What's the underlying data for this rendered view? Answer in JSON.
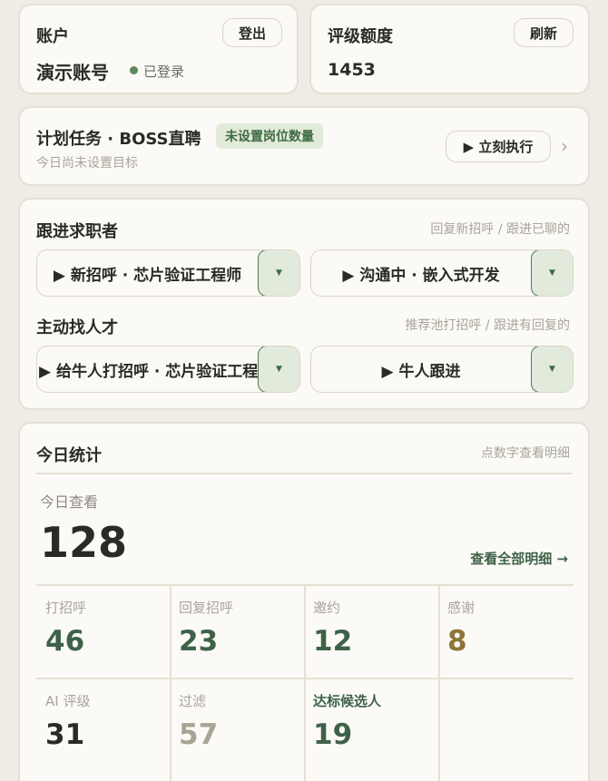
{
  "account": {
    "title": "账户",
    "logout_label": "登出",
    "name": "演示账号",
    "status": "已登录"
  },
  "rating": {
    "title": "评级额度",
    "refresh_label": "刷新",
    "value": "1453"
  },
  "plan": {
    "title": "计划任务 · BOSS直聘",
    "tag": "未设置岗位数量",
    "subtitle": "今日尚未设置目标",
    "run_label": "▶ 立刻执行",
    "chevron": "›"
  },
  "follow": {
    "title": "跟进求职者",
    "hint": "回复新招呼 / 跟进已聊的",
    "left_select": "▶ 新招呼 · 芯片验证工程师",
    "right_select": "▶ 沟通中 · 嵌入式开发"
  },
  "find": {
    "title": "主动找人才",
    "hint": "推荐池打招呼 / 跟进有回复的",
    "left_select": "▶ 给牛人打招呼 · 芯片验证工程师",
    "right_select": "▶ 牛人跟进"
  },
  "stats": {
    "title": "今日统计",
    "hint": "点数字查看明细",
    "views_label": "今日查看",
    "views_value": "128",
    "view_all": "查看全部明细 →",
    "cells": [
      {
        "label": "打招呼",
        "value": "46",
        "color": "#3e6248"
      },
      {
        "label": "回复招呼",
        "value": "23",
        "color": "#3e6248"
      },
      {
        "label": "邀约",
        "value": "12",
        "color": "#3e6248"
      },
      {
        "label": "感谢",
        "value": "8",
        "color": "#8f7437"
      },
      {
        "label": "AI 评级",
        "value": "31",
        "color": "#2b2b26"
      },
      {
        "label": "过滤",
        "value": "57",
        "color": "#a8a395"
      },
      {
        "label": "达标候选人",
        "value": "19",
        "color": "#3e6248"
      }
    ]
  }
}
